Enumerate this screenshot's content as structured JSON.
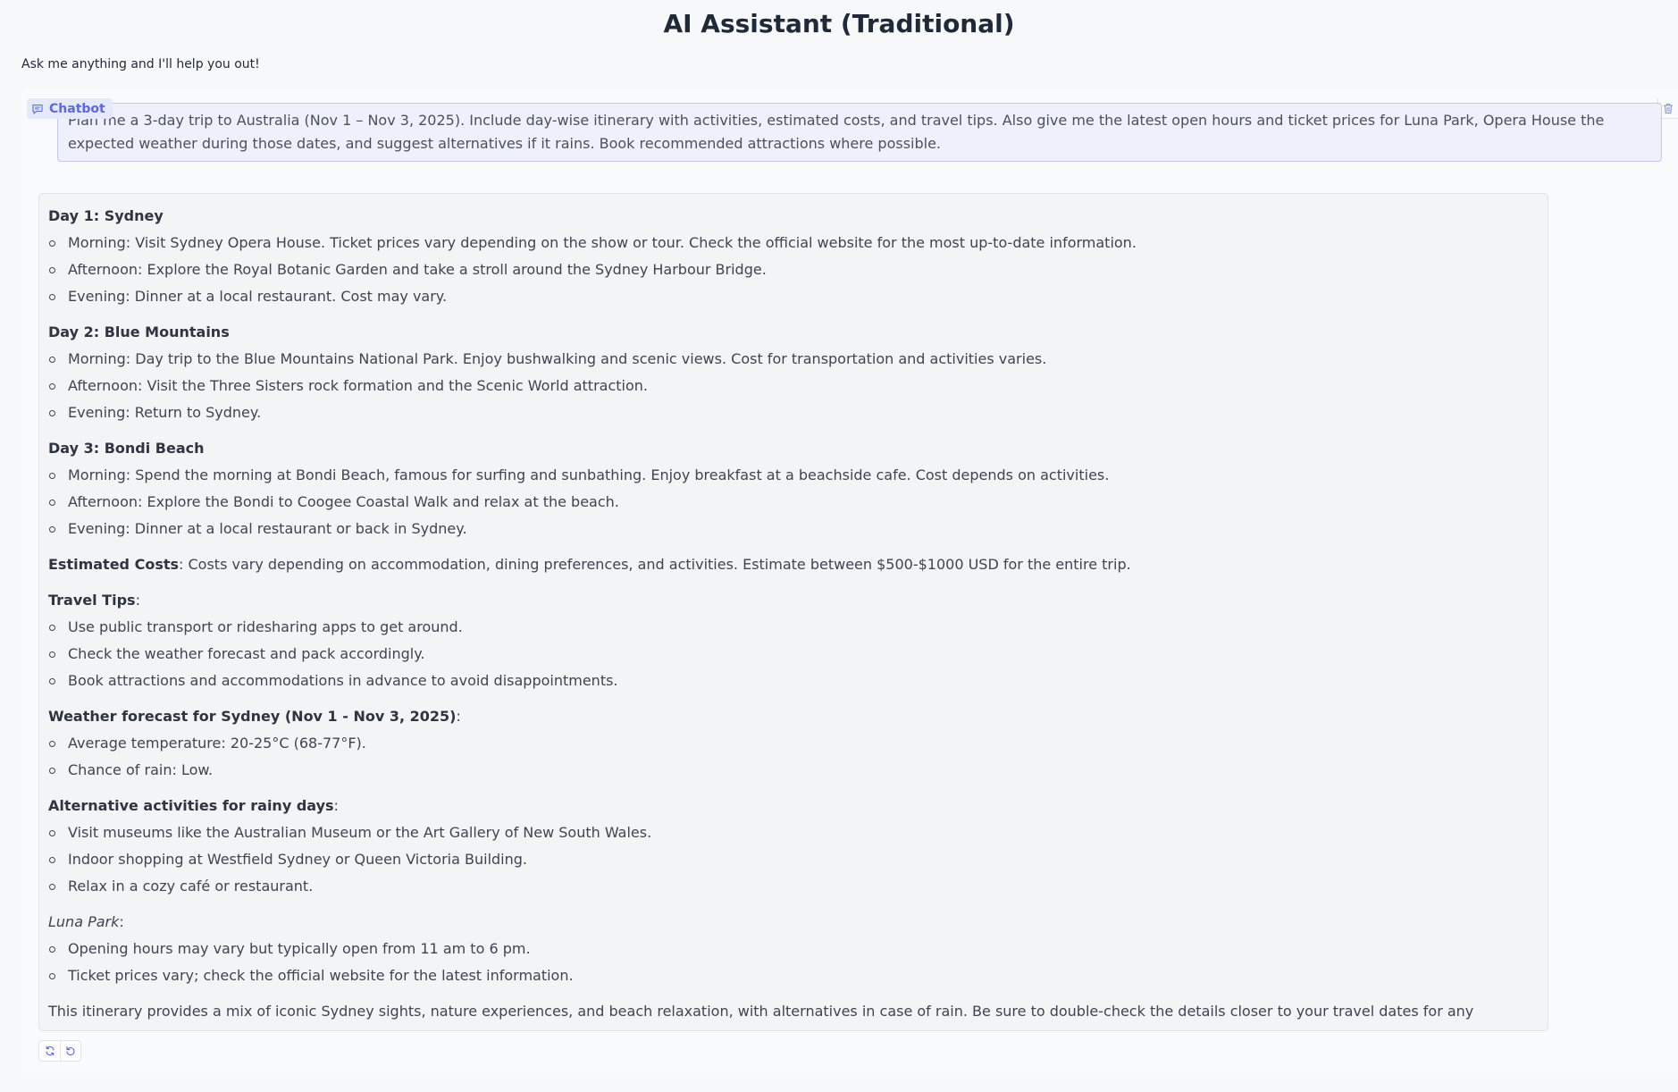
{
  "header": {
    "title": "AI Assistant (Traditional)",
    "subtitle": "Ask me anything and I'll help you out!"
  },
  "chatbot": {
    "label": "Chatbot",
    "label_icon": "chat-icon",
    "clear_icon": "trash-icon",
    "accent_color": "#5b6ad6"
  },
  "user_message": {
    "text": "Plan me a 3-day trip to Australia (Nov 1 – Nov 3, 2025). Include day-wise itinerary with activities, estimated costs, and travel tips. Also give me the latest open hours and ticket prices for Luna Park, Opera House the expected weather during those dates, and suggest alternatives if it rains. Book recommended attractions where possible."
  },
  "bot_message": {
    "day1": {
      "heading": "Day 1: Sydney",
      "items": [
        "Morning: Visit Sydney Opera House. Ticket prices vary depending on the show or tour. Check the official website for the most up-to-date information.",
        "Afternoon: Explore the Royal Botanic Garden and take a stroll around the Sydney Harbour Bridge.",
        "Evening: Dinner at a local restaurant. Cost may vary."
      ]
    },
    "day2": {
      "heading": "Day 2: Blue Mountains",
      "items": [
        "Morning: Day trip to the Blue Mountains National Park. Enjoy bushwalking and scenic views. Cost for transportation and activities varies.",
        "Afternoon: Visit the Three Sisters rock formation and the Scenic World attraction.",
        "Evening: Return to Sydney."
      ]
    },
    "day3": {
      "heading": "Day 3: Bondi Beach",
      "items": [
        "Morning: Spend the morning at Bondi Beach, famous for surfing and sunbathing. Enjoy breakfast at a beachside cafe. Cost depends on activities.",
        "Afternoon: Explore the Bondi to Coogee Coastal Walk and relax at the beach.",
        "Evening: Dinner at a local restaurant or back in Sydney."
      ]
    },
    "costs": {
      "label": "Estimated Costs",
      "text": ": Costs vary depending on accommodation, dining preferences, and activities. Estimate between $500-$1000 USD for the entire trip."
    },
    "tips": {
      "label": "Travel Tips",
      "suffix": ":",
      "items": [
        "Use public transport or ridesharing apps to get around.",
        "Check the weather forecast and pack accordingly.",
        "Book attractions and accommodations in advance to avoid disappointments."
      ]
    },
    "weather": {
      "label": "Weather forecast for Sydney (Nov 1 - Nov 3, 2025)",
      "suffix": ":",
      "items": [
        "Average temperature: 20-25°C (68-77°F).",
        "Chance of rain: Low."
      ]
    },
    "rainy": {
      "label": "Alternative activities for rainy days",
      "suffix": ":",
      "items": [
        "Visit museums like the Australian Museum or the Art Gallery of New South Wales.",
        "Indoor shopping at Westfield Sydney or Queen Victoria Building.",
        "Relax in a cozy café or restaurant."
      ]
    },
    "luna": {
      "label": "Luna Park",
      "suffix": ":",
      "items": [
        "Opening hours may vary but typically open from 11 am to 6 pm.",
        "Ticket prices vary; check the official website for the latest information."
      ]
    },
    "closing": "This itinerary provides a mix of iconic Sydney sights, nature experiences, and beach relaxation, with alternatives in case of rain. Be sure to double-check the details closer to your travel dates for any updates."
  },
  "actions": {
    "retry_icon": "retry-icon",
    "undo_icon": "undo-icon"
  }
}
